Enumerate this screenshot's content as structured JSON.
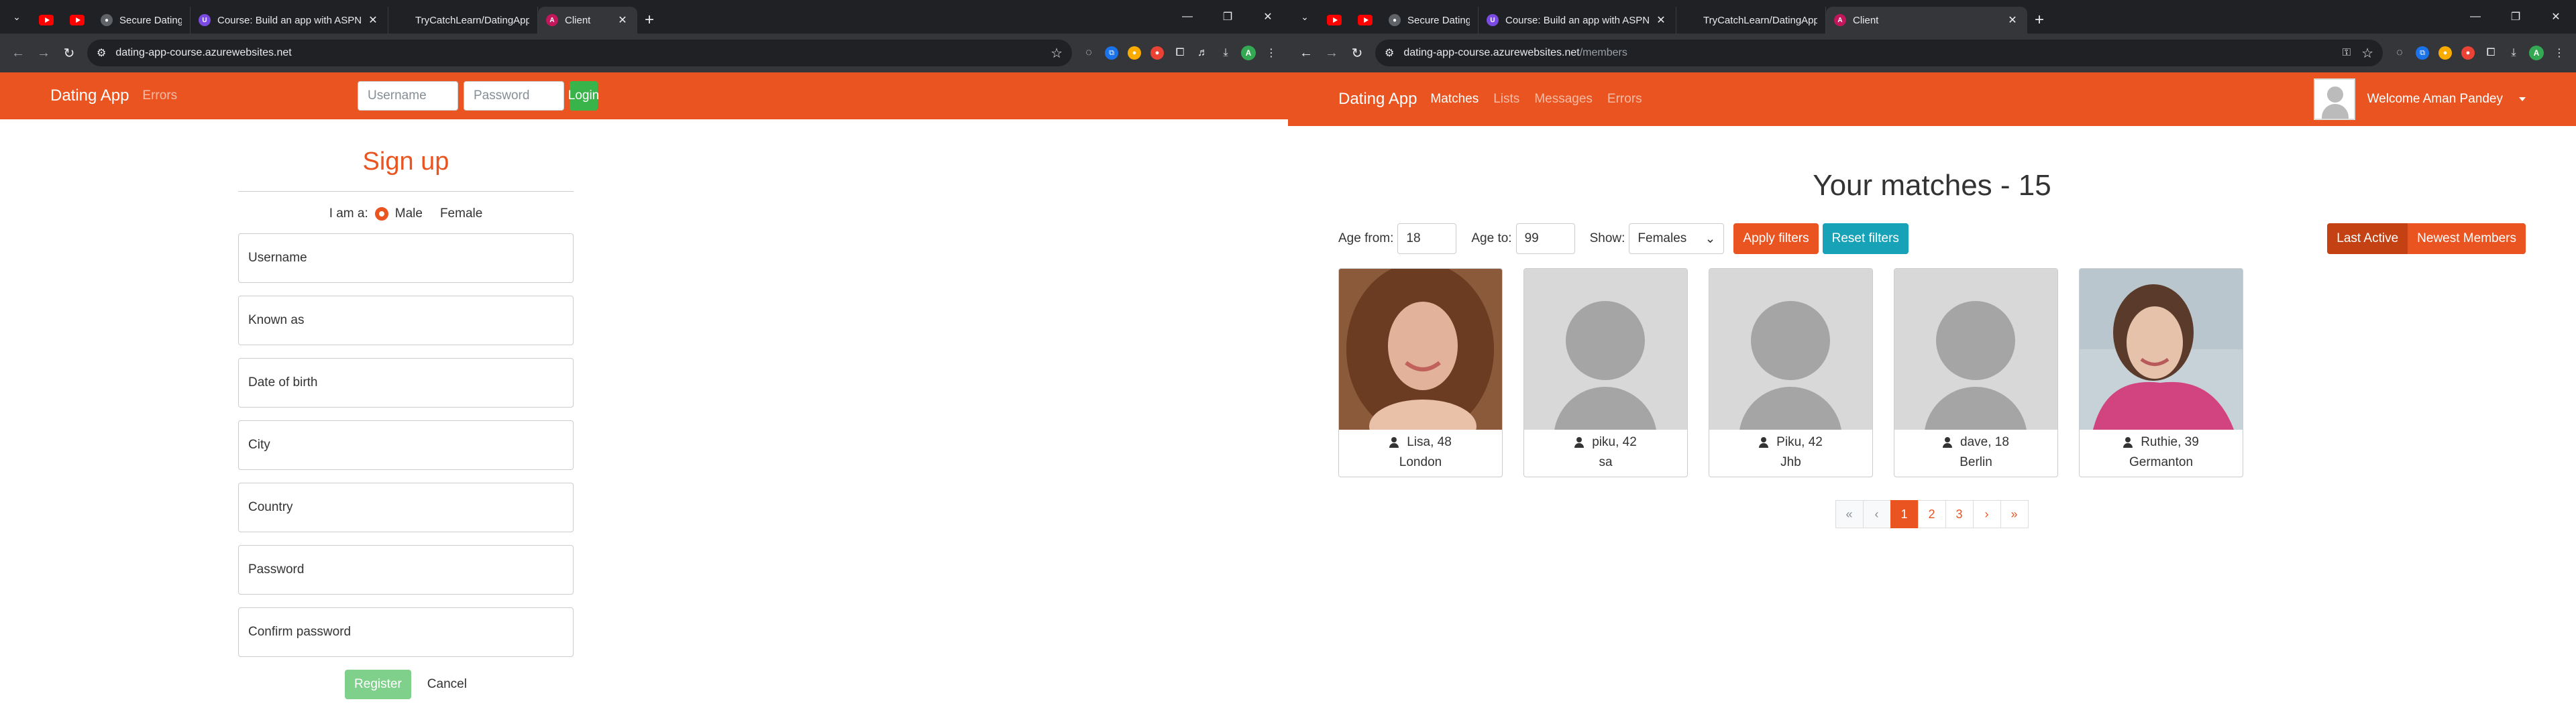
{
  "left": {
    "tabs": [
      {
        "title": "Secure Dating Platform Overvie"
      },
      {
        "title": "Course: Build an app with ASPN"
      },
      {
        "title": "TryCatchLearn/DatingApp"
      },
      {
        "title": "Client"
      }
    ],
    "url_host": "dating-app-course.azurewebsites.net",
    "url_path": "",
    "navbar": {
      "brand": "Dating App",
      "links": [
        "Errors"
      ],
      "username_placeholder": "Username",
      "password_placeholder": "Password",
      "login_label": "Login"
    },
    "signup": {
      "title": "Sign up",
      "gender_label": "I am a:",
      "gender_options": [
        "Male",
        "Female"
      ],
      "fields": [
        "Username",
        "Known as",
        "Date of birth",
        "City",
        "Country",
        "Password",
        "Confirm password"
      ],
      "register_label": "Register",
      "cancel_label": "Cancel"
    }
  },
  "right": {
    "tabs": [
      {
        "title": "Secure Dating Platform Overvie"
      },
      {
        "title": "Course: Build an app with ASPN"
      },
      {
        "title": "TryCatchLearn/DatingApp"
      },
      {
        "title": "Client"
      }
    ],
    "url_host": "dating-app-course.azurewebsites.net",
    "url_path": "/members",
    "navbar": {
      "brand": "Dating App",
      "links": [
        "Matches",
        "Lists",
        "Messages",
        "Errors"
      ],
      "welcome": "Welcome Aman Pandey"
    },
    "matches_title": "Your matches - 15",
    "filters": {
      "age_from_label": "Age from:",
      "age_from": "18",
      "age_to_label": "Age to:",
      "age_to": "99",
      "show_label": "Show:",
      "show_value": "Females",
      "apply_label": "Apply filters",
      "reset_label": "Reset filters",
      "sort_options": [
        "Last Active",
        "Newest Members"
      ]
    },
    "members": [
      {
        "name": "Lisa, 48",
        "city": "London"
      },
      {
        "name": "piku, 42",
        "city": "sa"
      },
      {
        "name": "Piku, 42",
        "city": "Jhb"
      },
      {
        "name": "dave, 18",
        "city": "Berlin"
      },
      {
        "name": "Ruthie, 39",
        "city": "Germanton"
      }
    ],
    "pagination": [
      "«",
      "‹",
      "1",
      "2",
      "3",
      "›",
      "»"
    ]
  },
  "colors": {
    "accent": "#e95420",
    "success": "#38b44a",
    "info": "#17a2b8",
    "chrome_dark": "#202124"
  }
}
